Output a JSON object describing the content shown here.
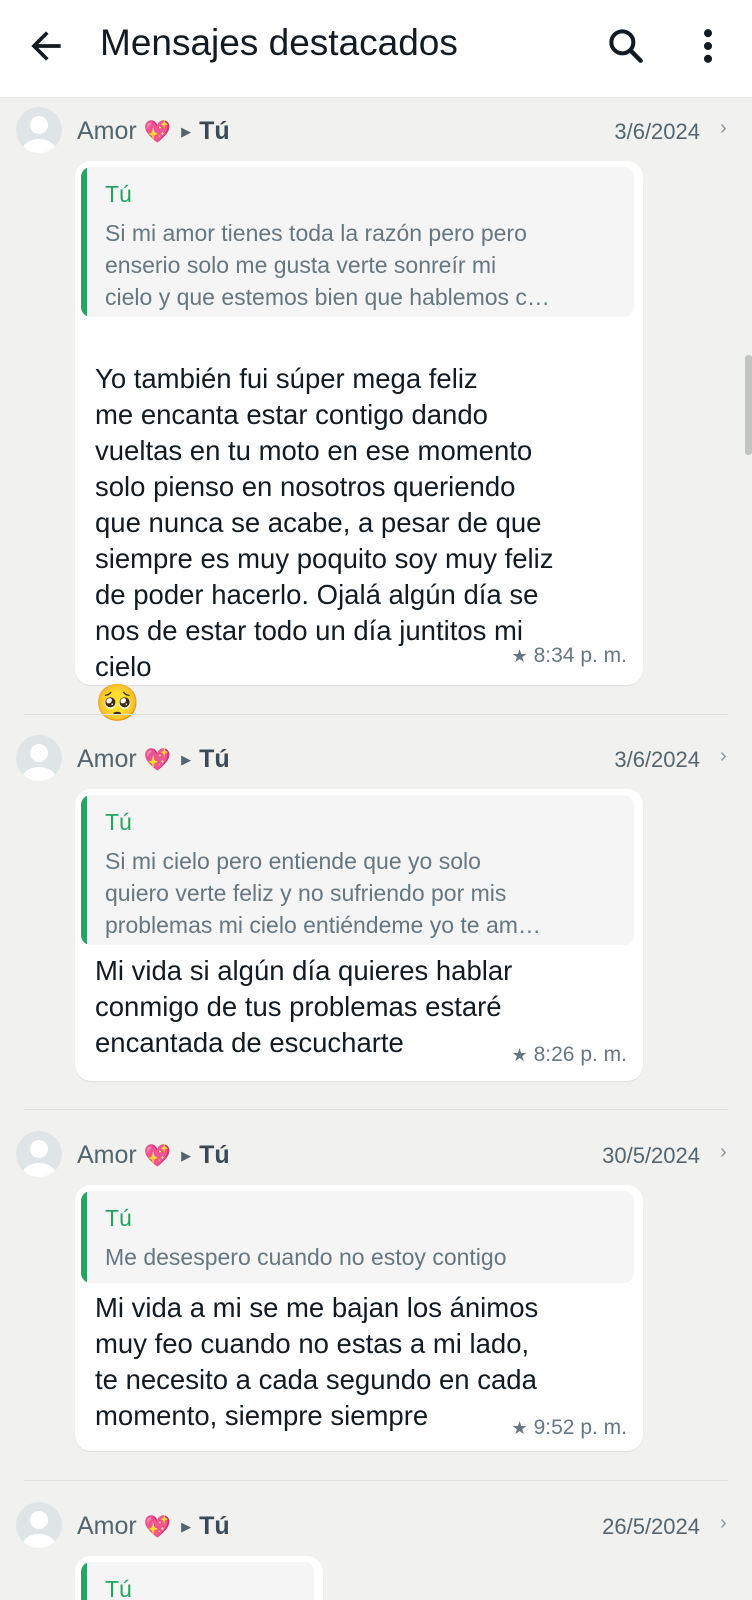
{
  "header": {
    "title": "Mensajes destacados",
    "back_icon": "arrow-back-icon",
    "search_icon": "search-icon",
    "menu_icon": "more-vertical-icon"
  },
  "colors": {
    "accent_green": "#25a464",
    "background": "#f1f2ef",
    "bubble": "#ffffff"
  },
  "messages": [
    {
      "sender": "Amor",
      "sender_emoji": "💖",
      "recipient": "Tú",
      "date": "3/6/2024",
      "quote_author": "Tú",
      "quote_text": "Si mi amor tienes toda la razón pero pero\nenserio solo me gusta verte sonreír mi\ncielo y que estemos bien que hablemos c…",
      "text": "Yo también fui súper mega feliz\nme encanta estar contigo dando\nvueltas en tu moto en ese momento\nsolo pienso en nosotros queriendo\nque nunca se acabe, a pesar de que\nsiempre es muy poquito soy muy feliz\nde poder hacerlo. Ojalá algún día se\nnos de estar todo un día juntitos mi\ncielo",
      "text_emoji": "🥺",
      "time": "8:34 p. m.",
      "starred": true
    },
    {
      "sender": "Amor",
      "sender_emoji": "💖",
      "recipient": "Tú",
      "date": "3/6/2024",
      "quote_author": "Tú",
      "quote_text": "Si mi cielo pero entiende que yo solo\nquiero verte feliz y no sufriendo por mis\nproblemas mi cielo entiéndeme yo te am…",
      "text": "Mi vida si algún día quieres hablar\nconmigo de tus problemas estaré\nencantada de escucharte",
      "time": "8:26 p. m.",
      "starred": true
    },
    {
      "sender": "Amor",
      "sender_emoji": "💖",
      "recipient": "Tú",
      "date": "30/5/2024",
      "quote_author": "Tú",
      "quote_text": "Me desespero cuando no estoy contigo",
      "text": "Mi vida a mi se me bajan los ánimos\nmuy feo cuando no estas a mi lado,\nte necesito a cada segundo en cada\nmomento, siempre siempre",
      "time": "9:52 p. m.",
      "starred": true
    },
    {
      "sender": "Amor",
      "sender_emoji": "💖",
      "recipient": "Tú",
      "date": "26/5/2024",
      "quote_author": "Tú"
    }
  ]
}
